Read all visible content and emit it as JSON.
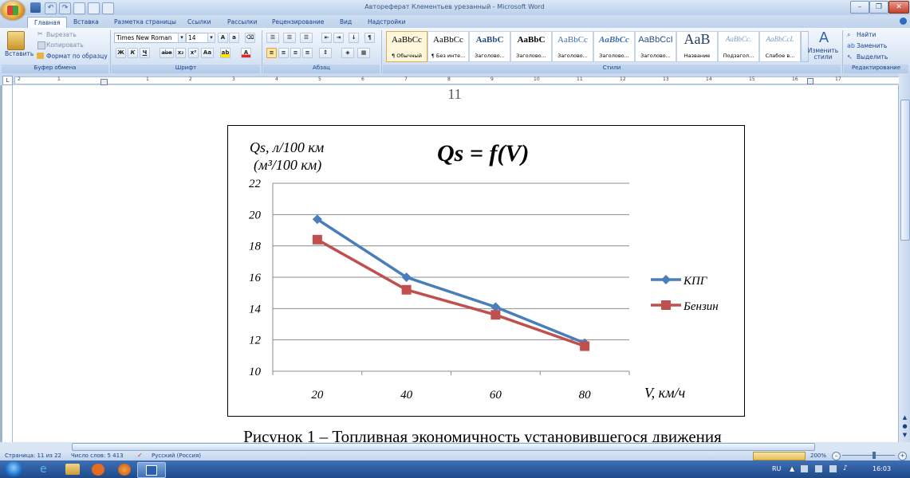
{
  "window": {
    "title": "Автореферат Клементьев урезанный - Microsoft Word"
  },
  "tabs": [
    "Главная",
    "Вставка",
    "Разметка страницы",
    "Ссылки",
    "Рассылки",
    "Рецензирование",
    "Вид",
    "Надстройки"
  ],
  "ribbon": {
    "clipboard": {
      "paste": "Вставить",
      "cut": "Вырезать",
      "copy": "Копировать",
      "format_painter": "Формат по образцу",
      "label": "Буфер обмена"
    },
    "font": {
      "name": "Times New Roman",
      "size": "14",
      "label": "Шрифт",
      "bold": "Ж",
      "italic": "К",
      "underline": "Ч",
      "strike": "abe",
      "sub": "x₂",
      "sup": "x²",
      "case": "Aa"
    },
    "paragraph": {
      "label": "Абзац"
    },
    "styles": {
      "label": "Стили",
      "items": [
        {
          "sample": "AaBbCc",
          "name": "¶ Обычный"
        },
        {
          "sample": "AaBbCc",
          "name": "¶ Без инте..."
        },
        {
          "sample": "AaBbC",
          "name": "Заголово..."
        },
        {
          "sample": "AaBbC",
          "name": "Заголово..."
        },
        {
          "sample": "AaBbCc",
          "name": "Заголово..."
        },
        {
          "sample": "AaBbCc",
          "name": "Заголово..."
        },
        {
          "sample": "AaBbCcI",
          "name": "Заголово..."
        },
        {
          "sample": "AaB",
          "name": "Название"
        },
        {
          "sample": "AaBbCc.",
          "name": "Подзагол..."
        },
        {
          "sample": "AaBbCcL",
          "name": "Слабое в..."
        }
      ],
      "change": "Изменить стили"
    },
    "editing": {
      "label": "Редактирование",
      "find": "Найти",
      "replace": "Заменить",
      "select": "Выделить"
    }
  },
  "ruler_numbers": [
    "2",
    "1",
    "1",
    "2",
    "3",
    "4",
    "5",
    "6",
    "7",
    "8",
    "9",
    "10",
    "11",
    "12",
    "13",
    "14",
    "15",
    "16",
    "17"
  ],
  "document": {
    "page_number": "11",
    "caption": "Рисунок 1 – Топливная экономичность установившегося движения"
  },
  "chart_data": {
    "type": "line",
    "title": "Qs = f(V)",
    "ylabel_line1": "Qs, л/100 км",
    "ylabel_line2": "(м³/100 км)",
    "xlabel": "V, км/ч",
    "categories": [
      "20",
      "40",
      "60",
      "80"
    ],
    "ylim": [
      10,
      22
    ],
    "yticks": [
      "10",
      "12",
      "14",
      "16",
      "18",
      "20",
      "22"
    ],
    "grid": true,
    "legend": "right",
    "series": [
      {
        "name": "КПГ",
        "values": [
          19.7,
          16.0,
          14.1,
          11.8
        ],
        "color": "#4a7ebb",
        "marker": "diamond"
      },
      {
        "name": "Бензин",
        "values": [
          18.4,
          15.2,
          13.6,
          11.6
        ],
        "color": "#c0504d",
        "marker": "square"
      }
    ]
  },
  "statusbar": {
    "page": "Страница: 11 из 22",
    "words": "Число слов: 5 413",
    "language": "Русский (Россия)",
    "zoom": "200%"
  },
  "taskbar": {
    "lang": "RU",
    "time": "16:03"
  }
}
